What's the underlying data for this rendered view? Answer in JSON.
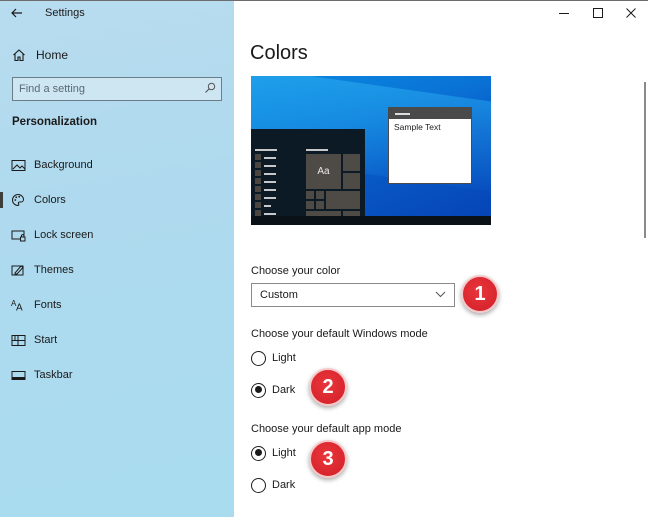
{
  "window": {
    "app_title": "Settings",
    "controls": {
      "minimize": "minimize-icon",
      "maximize": "maximize-icon",
      "close": "close-icon"
    }
  },
  "sidebar": {
    "home_label": "Home",
    "search_placeholder": "Find a setting",
    "section_title": "Personalization",
    "items": [
      {
        "label": "Background",
        "icon": "image-icon",
        "selected": false
      },
      {
        "label": "Colors",
        "icon": "palette-icon",
        "selected": true
      },
      {
        "label": "Lock screen",
        "icon": "lock-screen-icon",
        "selected": false
      },
      {
        "label": "Themes",
        "icon": "themes-icon",
        "selected": false
      },
      {
        "label": "Fonts",
        "icon": "fonts-icon",
        "selected": false
      },
      {
        "label": "Start",
        "icon": "start-icon",
        "selected": false
      },
      {
        "label": "Taskbar",
        "icon": "taskbar-icon",
        "selected": false
      }
    ]
  },
  "main": {
    "page_title": "Colors",
    "preview": {
      "sample_text": "Sample Text",
      "tile_text": "Aa"
    },
    "choose_color": {
      "label": "Choose your color",
      "selected": "Custom"
    },
    "windows_mode": {
      "label": "Choose your default Windows mode",
      "options": [
        "Light",
        "Dark"
      ],
      "selected": "Dark"
    },
    "app_mode": {
      "label": "Choose your default app mode",
      "options": [
        "Light",
        "Dark"
      ],
      "selected": "Light"
    },
    "annotations": [
      "1",
      "2",
      "3"
    ]
  },
  "colors": {
    "sidebar_bg": "#aed9ee",
    "badge_red": "#d9262e",
    "accent_blue": "#0a74d6"
  }
}
